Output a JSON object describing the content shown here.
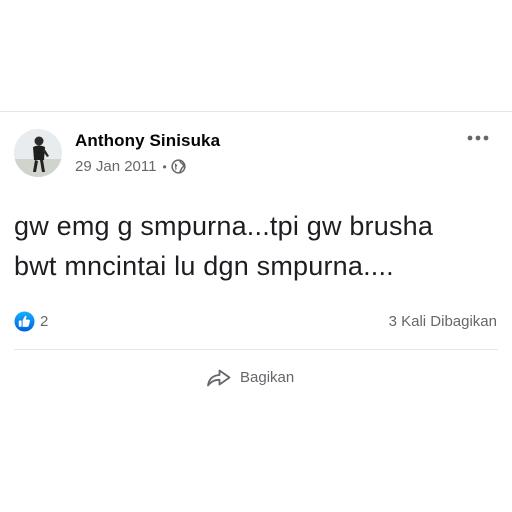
{
  "post": {
    "author": "Anthony Sinisuka",
    "date": "29 Jan 2011",
    "separator": "•",
    "privacy_icon": "globe-icon",
    "more_icon": "more-horizontal-icon",
    "text_line1": "gw emg g smpurna...tpi gw brusha",
    "text_line2": "bwt mncintai lu dgn smpurna...."
  },
  "stats": {
    "reaction_icon": "like-icon",
    "reaction_count": "2",
    "shares": "3 Kali Dibagikan"
  },
  "actions": {
    "share_icon": "share-arrow-icon",
    "share_label": "Bagikan"
  },
  "colors": {
    "like_blue": "#1877f2",
    "secondary_text": "#65676b",
    "primary_text": "#050505"
  }
}
